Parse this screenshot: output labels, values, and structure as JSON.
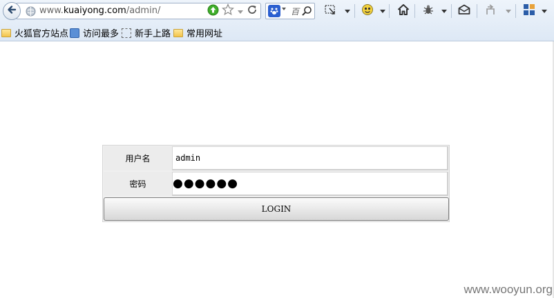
{
  "browser": {
    "url_prefix": "www.",
    "url_domain": "kuaiyong.com",
    "url_path": "/admin/",
    "search_placeholder": "百",
    "icons": [
      "back-icon",
      "site-globe-icon",
      "go-icon",
      "bookmark-star-icon",
      "dropdown-icon",
      "reload-icon",
      "baidu-icon",
      "search-icon",
      "screenshot-icon",
      "addon-icon",
      "home-icon",
      "bug-icon",
      "mail-icon",
      "undo-icon",
      "menu-icon"
    ]
  },
  "bookmarks": [
    {
      "label": "火狐官方站点",
      "icon": "folder-icon"
    },
    {
      "label": "访问最多",
      "icon": "most-visited-icon"
    },
    {
      "label": "新手上路",
      "icon": "getting-started-icon"
    },
    {
      "label": "常用网址",
      "icon": "folder-icon"
    }
  ],
  "login": {
    "username_label": "用户名",
    "username_value": "admin",
    "password_label": "密码",
    "password_value": "●●●●●●",
    "submit_label": "LOGIN"
  },
  "watermark": "www.wooyun.org"
}
